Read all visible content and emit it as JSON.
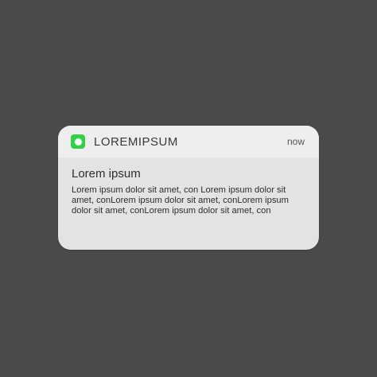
{
  "notification": {
    "app_name": "LOREMIPSUM",
    "timestamp": "now",
    "app_icon": "app-badge-icon",
    "app_icon_color": "#33d14a",
    "title": "Lorem ipsum",
    "body": "Lorem ipsum dolor sit amet, con Lorem ipsum dolor sit amet, conLorem ipsum dolor sit amet, conLorem ipsum dolor sit amet, conLorem ipsum dolor sit amet, con"
  }
}
